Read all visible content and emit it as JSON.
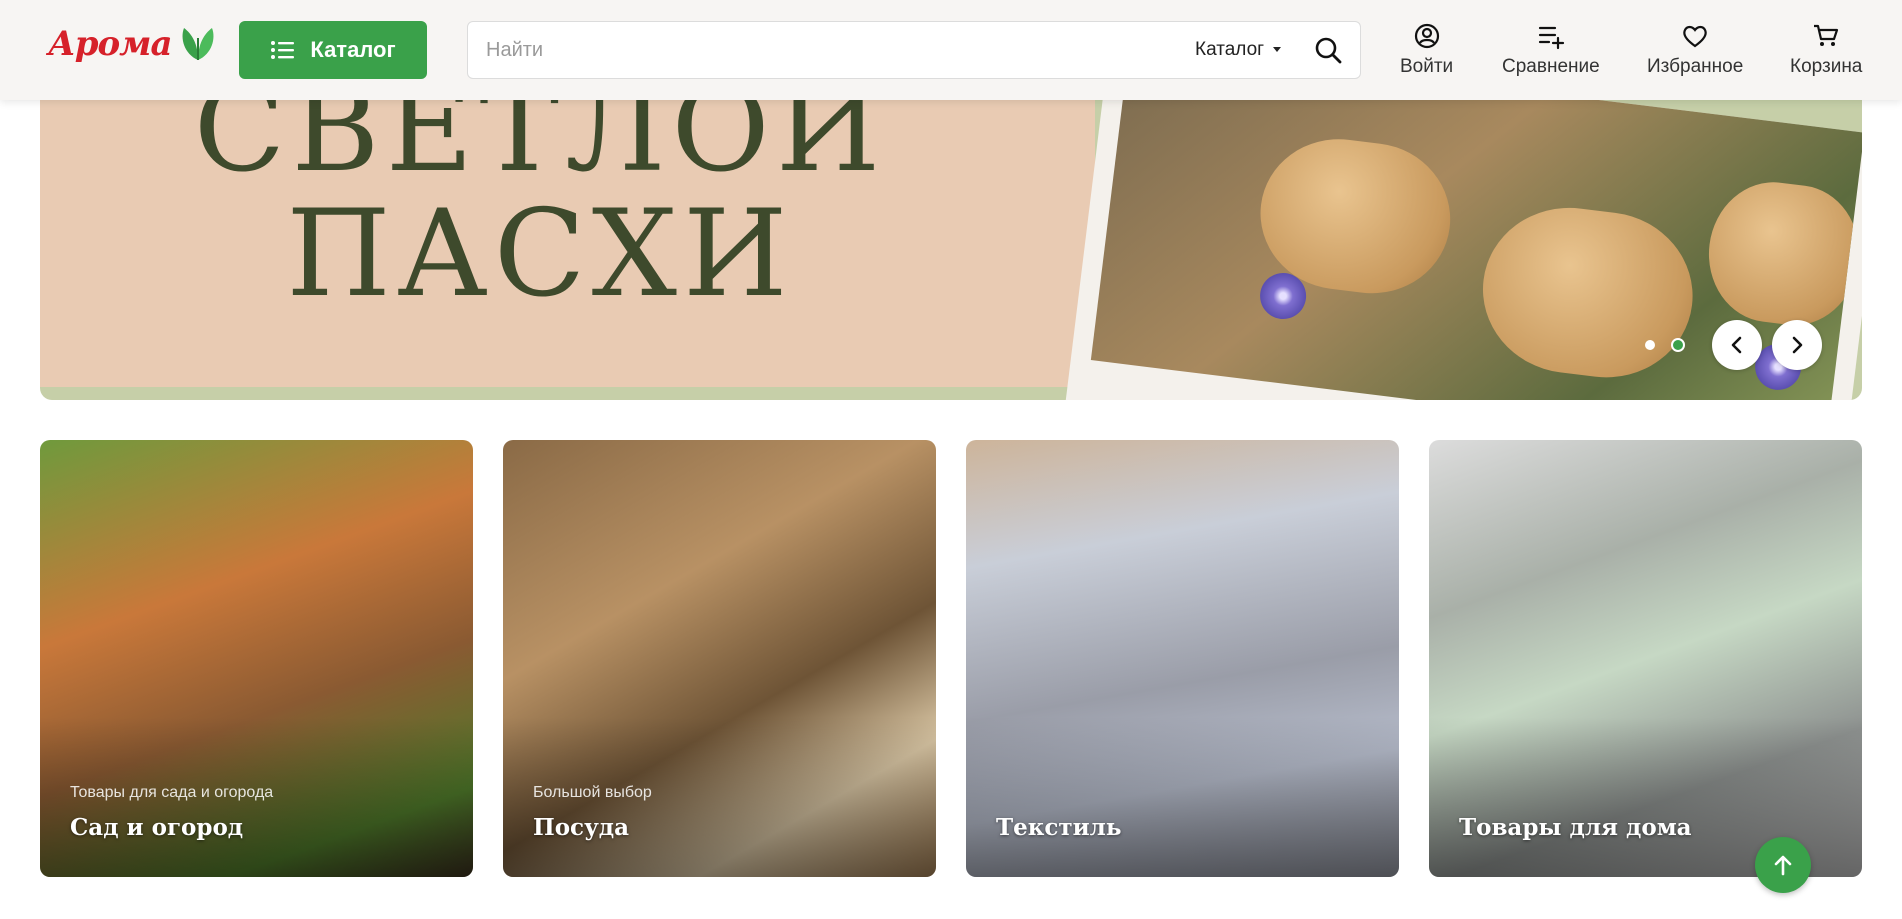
{
  "header": {
    "logo_text": "Арома",
    "catalog_button": "Каталог",
    "search": {
      "placeholder": "Найти",
      "category": "Каталог"
    },
    "nav": [
      {
        "label": "Войти",
        "icon": "user-icon"
      },
      {
        "label": "Сравнение",
        "icon": "compare-icon"
      },
      {
        "label": "Избранное",
        "icon": "heart-icon"
      },
      {
        "label": "Корзина",
        "icon": "cart-icon"
      }
    ]
  },
  "banner": {
    "line1": "СВЕТЛОЙ",
    "line2": "ПАСХИ",
    "slides_total": 2,
    "active_slide": 2
  },
  "categories": [
    {
      "subtitle": "Товары для сада и огорода",
      "title": "Сад и огород"
    },
    {
      "subtitle": "Большой выбор",
      "title": "Посуда"
    },
    {
      "subtitle": "",
      "title": "Текстиль"
    },
    {
      "subtitle": "",
      "title": "Товары для дома"
    }
  ],
  "colors": {
    "accent": "#3aa14a",
    "logo_red": "#d6212a",
    "banner_peach": "#e9cbb3",
    "banner_title": "#3e4a2c"
  }
}
